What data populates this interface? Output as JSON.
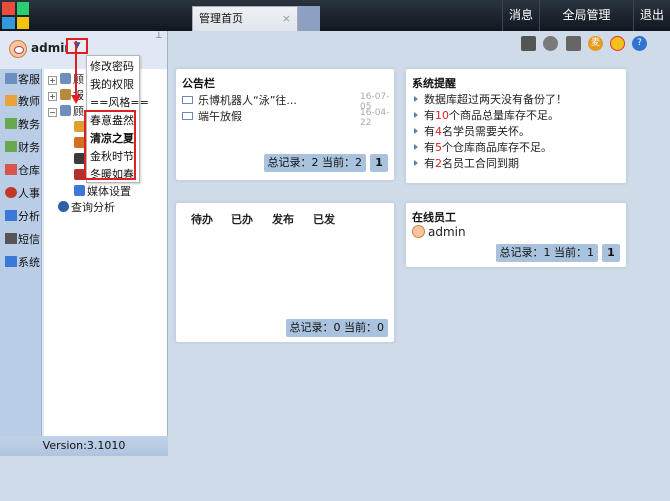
{
  "topbar": {
    "tab_title": "管理首页",
    "tab_close": "×",
    "buttons": {
      "message": "消息",
      "global": "全局管理",
      "logout": "退出"
    },
    "logo_colors": [
      "#e74c3c",
      "#2ecc71",
      "#3498db",
      "#f1c40f"
    ]
  },
  "user": {
    "name": "admin",
    "dropdown_arrow": "▼",
    "pin": "⊥"
  },
  "dropdown": {
    "items": [
      "修改密码",
      "我的权限",
      "==风格==",
      "春意盎然",
      "清凉之夏",
      "金秋时节",
      "冬暖如春"
    ]
  },
  "sidenav": {
    "items": [
      {
        "label": "客服",
        "icon": "customer-icon",
        "color": "#6c8fbf"
      },
      {
        "label": "教师",
        "icon": "teacher-icon",
        "color": "#e8a33a"
      },
      {
        "label": "教务",
        "icon": "academic-icon",
        "color": "#6aa84f"
      },
      {
        "label": "财务",
        "icon": "finance-icon",
        "color": "#6aa84f"
      },
      {
        "label": "仓库",
        "icon": "warehouse-icon",
        "color": "#d9534f"
      },
      {
        "label": "人事",
        "icon": "hr-icon",
        "color": "#c0392b"
      },
      {
        "label": "分析",
        "icon": "analysis-icon",
        "color": "#3c78d8"
      },
      {
        "label": "短信",
        "icon": "sms-icon",
        "color": "#555555"
      },
      {
        "label": "系统",
        "icon": "system-icon",
        "color": "#3c78d8"
      }
    ]
  },
  "tree": {
    "rows": [
      {
        "expander": "⊞",
        "label": "顾"
      },
      {
        "expander": "⊞",
        "label": "报"
      },
      {
        "expander": "⊟",
        "label": "顾"
      },
      {
        "expander": "",
        "label": "媒体设置"
      },
      {
        "expander": "",
        "label": "查询分析"
      }
    ]
  },
  "version": "Version:3.1010",
  "toolbar_icons": [
    "book-icon",
    "globe-icon",
    "printer-icon",
    "mai-badge-icon",
    "smiley-icon",
    "help-icon"
  ],
  "toolbar_badge": "麦",
  "toolbar_help": "?",
  "notice": {
    "title": "公告栏",
    "items": [
      {
        "text": "乐博机器人“泳”往...",
        "date": "16-07-05"
      },
      {
        "text": "端午放假",
        "date": "16-04-22"
      }
    ],
    "pager": {
      "text": "总记录：2 当前：2",
      "page": "1"
    }
  },
  "reminder": {
    "title": "系统提醒",
    "items": [
      {
        "pre": "数据库超过两天没有备份了！",
        "num": "",
        "post": ""
      },
      {
        "pre": "有",
        "num": "10",
        "post": "个商品总量库存不足。"
      },
      {
        "pre": "有",
        "num": "4",
        "post": "名学员需要关怀。"
      },
      {
        "pre": "有",
        "num": "5",
        "post": "个仓库商品库存不足。"
      },
      {
        "pre": "有",
        "num": "2",
        "post": "名员工合同到期"
      }
    ]
  },
  "todo": {
    "tabs": [
      "待办",
      "已办",
      "发布",
      "已发"
    ],
    "pager": {
      "text": "总记录：0 当前：0"
    }
  },
  "online": {
    "title": "在线员工",
    "user": "admin",
    "pager": {
      "text": "总记录：1 当前：1",
      "page": "1"
    }
  }
}
